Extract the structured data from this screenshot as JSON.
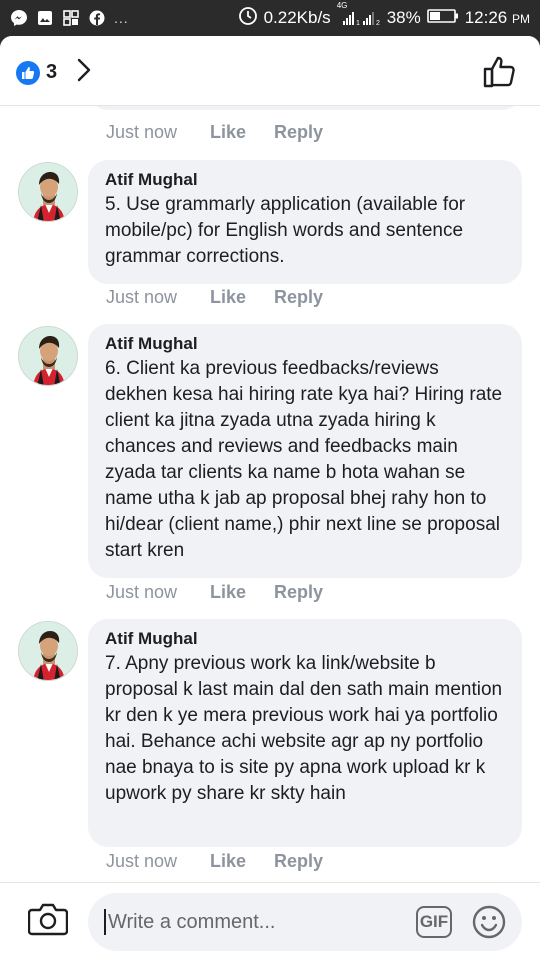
{
  "status_bar": {
    "speed": "0.22Kb/s",
    "network_label": "4G",
    "battery": "38%",
    "time": "12:26",
    "ampm": "PM",
    "more_dots": "..."
  },
  "header": {
    "like_count": "3"
  },
  "previous_comment_meta": {
    "time": "Just now",
    "like_label": "Like",
    "reply_label": "Reply"
  },
  "comments": [
    {
      "author": "Atif Mughal",
      "text": "5. Use grammarly application (available for mobile/pc) for English words and sentence grammar corrections.",
      "time": "Just now",
      "like_label": "Like",
      "reply_label": "Reply"
    },
    {
      "author": "Atif Mughal",
      "text": "6. Client ka previous feedbacks/reviews dekhen kesa hai hiring rate kya hai? Hiring rate client ka jitna zyada utna zyada hiring k chances and reviews and feedbacks main zyada tar clients ka name b hota wahan se name utha k jab ap proposal bhej rahy hon to hi/dear (client name,) phir next line se proposal start kren",
      "time": "Just now",
      "like_label": "Like",
      "reply_label": "Reply"
    },
    {
      "author": "Atif Mughal",
      "text": "7. Apny previous work ka link/website b proposal k last main dal den sath main mention kr den k ye mera previous work hai ya portfolio hai. Behance achi website agr ap ny portfolio nae bnaya to is site py apna work upload kr k upwork py share kr skty hain",
      "time": "Just now",
      "like_label": "Like",
      "reply_label": "Reply"
    }
  ],
  "composer": {
    "placeholder": "Write a comment...",
    "gif_label": "GIF"
  },
  "colors": {
    "accent": "#1877f2",
    "bubble": "#f0f2f5",
    "meta_text": "#8d949e"
  }
}
